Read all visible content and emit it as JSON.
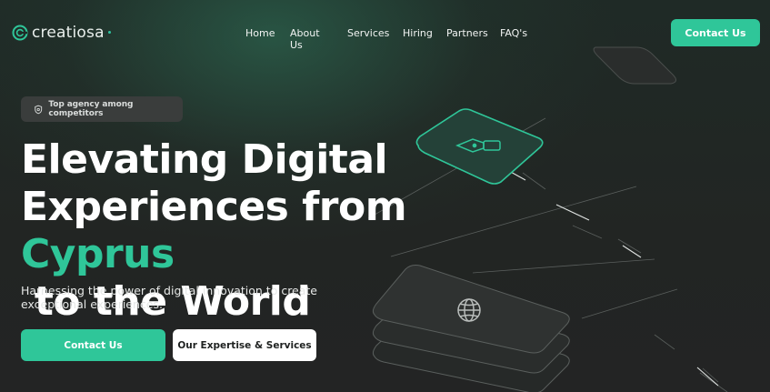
{
  "brand": {
    "name": "creatiosa"
  },
  "nav": {
    "items": [
      "Home",
      "About Us",
      "Services",
      "Hiring",
      "Partners",
      "FAQ's"
    ],
    "cta": "Contact Us"
  },
  "hero": {
    "badge": "Top agency among competitors",
    "headline": {
      "line1": "Elevating Digital",
      "line2": "Experiences from",
      "accent": "Cyprus",
      "line3_rest": " to the World"
    },
    "subtext": "Harnessing the power of digital innovation to create exceptional experiences.",
    "primary_cta": "Contact Us",
    "secondary_cta": "Our Expertise & Services"
  },
  "colors": {
    "accent": "#2fc699",
    "background": "#222523",
    "card": "#3a3d3c"
  },
  "icons": {
    "logo": "logo-ring-icon",
    "badge": "shield-icon",
    "pen_card": "pen-nib-icon",
    "globe_card": "globe-icon"
  }
}
